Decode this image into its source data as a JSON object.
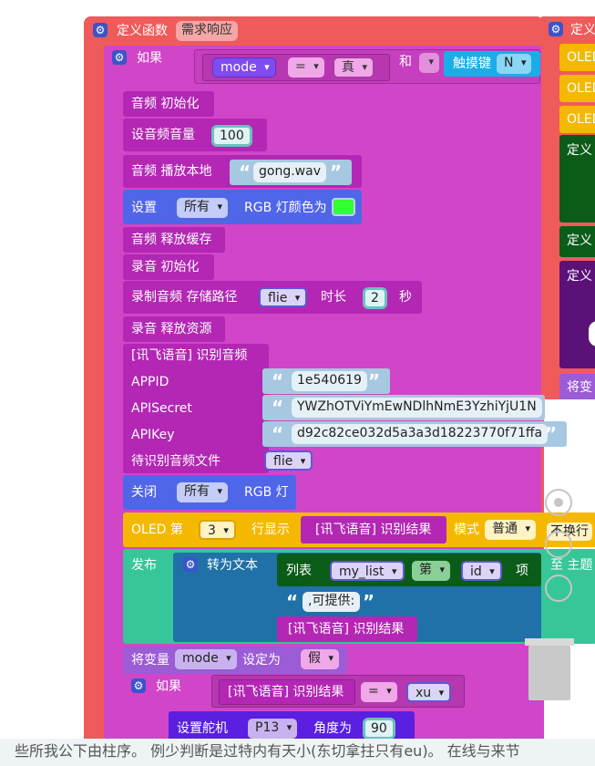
{
  "func1": {
    "kw": "定义函数",
    "name": "需求响应"
  },
  "if1": {
    "kw": "如果",
    "var": "mode",
    "op": "=",
    "val": "真",
    "and": "和",
    "touch": "触摸键",
    "key": "N"
  },
  "audio_init": "音频 初始化",
  "set_volume": {
    "label": "设音频音量",
    "value": "100"
  },
  "play_local": {
    "label": "音频 播放本地",
    "file": "gong.wav"
  },
  "rgb_set": {
    "label": "设置",
    "target": "所有",
    "suffix": "RGB 灯颜色为",
    "color": "#33ff33"
  },
  "audio_release": "音频 释放缓存",
  "record_init": "录音 初始化",
  "record": {
    "label": "录制音频 存储路径",
    "path": "flie",
    "dur_label": "时长",
    "dur": "2",
    "unit": "秒"
  },
  "record_release": "录音 释放资源",
  "xf": {
    "title": "[讯飞语音] 识别音频",
    "appid_label": "APPID",
    "appid": "1e540619",
    "secret_label": "APISecret",
    "secret": "YWZhOTViYmEwNDlhNmE3YzhiYjU1N",
    "key_label": "APIKey",
    "key": "d92c82ce032d5a3a3d18223770f71ffa",
    "file_label": "待识别音频文件",
    "file": "flie"
  },
  "rgb_off": {
    "label": "关闭",
    "target": "所有",
    "suffix": "RGB 灯"
  },
  "oled": {
    "label": "OLED 第",
    "line": "3",
    "suffix": "行显示",
    "content": "[讯飞语音] 识别结果",
    "mode_label": "模式",
    "mode": "普通",
    "wrap": "不换行"
  },
  "publish": {
    "label": "发布",
    "totext": "转为文本",
    "list_label": "列表",
    "list": "my_list",
    "nth": "第",
    "id": "id",
    "item": "项",
    "provide": ",可提供:",
    "result": "[讯飞语音] 识别结果",
    "to": "至 主题"
  },
  "setvar": {
    "label": "将变量",
    "var": "mode",
    "to": "设定为",
    "val": "假"
  },
  "if2": {
    "kw": "如果",
    "result": "[讯飞语音] 识别结果",
    "op": "=",
    "val": "xu"
  },
  "servo": {
    "label": "设置舵机",
    "pin": "P13",
    "angle_label": "角度为",
    "angle": "90"
  },
  "right": {
    "def_top": "定义",
    "oled1": "OLED",
    "oled2": "OLED",
    "oled3": "OLED",
    "def1": "定义",
    "def2": "定义",
    "def3": "定义",
    "var": "将变"
  },
  "bottom_text": "些所我公下由柱序。 例少判断是过特内有天小(东切拿拄只有eu)。 在线与来节"
}
